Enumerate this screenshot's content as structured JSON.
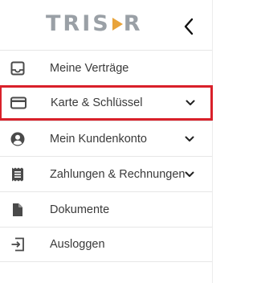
{
  "header": {
    "logo_text": "TRISOR",
    "back_icon": "chevron-left-icon"
  },
  "colors": {
    "highlight_border": "#d9202a",
    "logo_gray": "#9aa0a6",
    "logo_accent": "#e8a33a",
    "icon_color": "#4a4a4a"
  },
  "menu": {
    "items": [
      {
        "label": "Meine Verträge",
        "icon": "inbox-icon",
        "has_chevron": false
      },
      {
        "label": "Karte & Schlüssel",
        "icon": "credit-card-icon",
        "has_chevron": true,
        "highlighted": true
      },
      {
        "label": "Mein Kundenkonto",
        "icon": "account-circle-icon",
        "has_chevron": true
      },
      {
        "label": "Zahlungen & Rechnungen",
        "icon": "receipt-icon",
        "has_chevron": true
      },
      {
        "label": "Dokumente",
        "icon": "document-icon",
        "has_chevron": false
      },
      {
        "label": "Ausloggen",
        "icon": "logout-icon",
        "has_chevron": false
      }
    ]
  }
}
